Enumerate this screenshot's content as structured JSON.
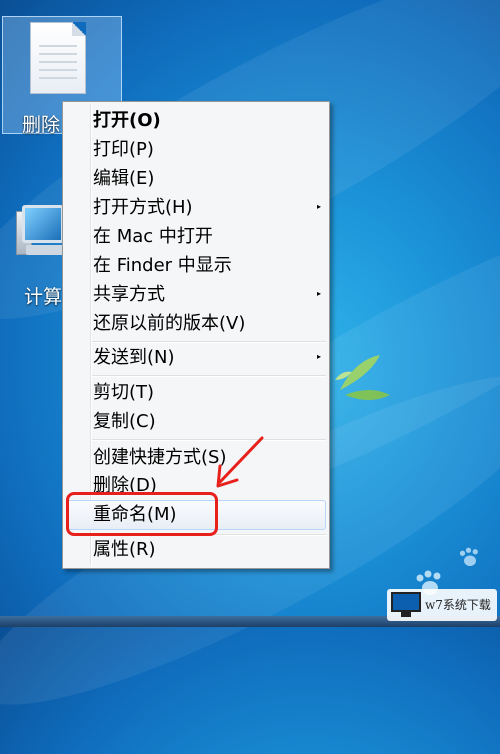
{
  "desktop": {
    "file_icon": {
      "label": "删除"
    },
    "computer_icon": {
      "label": "计算"
    }
  },
  "context_menu": {
    "items": [
      {
        "label": "打开(O)",
        "bold": true
      },
      {
        "label": "打印(P)"
      },
      {
        "label": "编辑(E)"
      },
      {
        "label": "打开方式(H)",
        "submenu": true
      },
      {
        "label": "在 Mac 中打开"
      },
      {
        "label": "在 Finder 中显示"
      },
      {
        "label": "共享方式",
        "submenu": true
      },
      {
        "label": "还原以前的版本(V)"
      },
      {
        "label": "发送到(N)",
        "submenu": true
      },
      {
        "label": "剪切(T)"
      },
      {
        "label": "复制(C)"
      },
      {
        "label": "创建快捷方式(S)"
      },
      {
        "label": "删除(D)"
      },
      {
        "label": "重命名(M)",
        "highlighted": true
      },
      {
        "label": "属性(R)"
      }
    ],
    "submenu_arrow": "▸"
  },
  "annotation": {
    "color": "#e8201c"
  },
  "watermark": {
    "text": "w7系统下载"
  }
}
